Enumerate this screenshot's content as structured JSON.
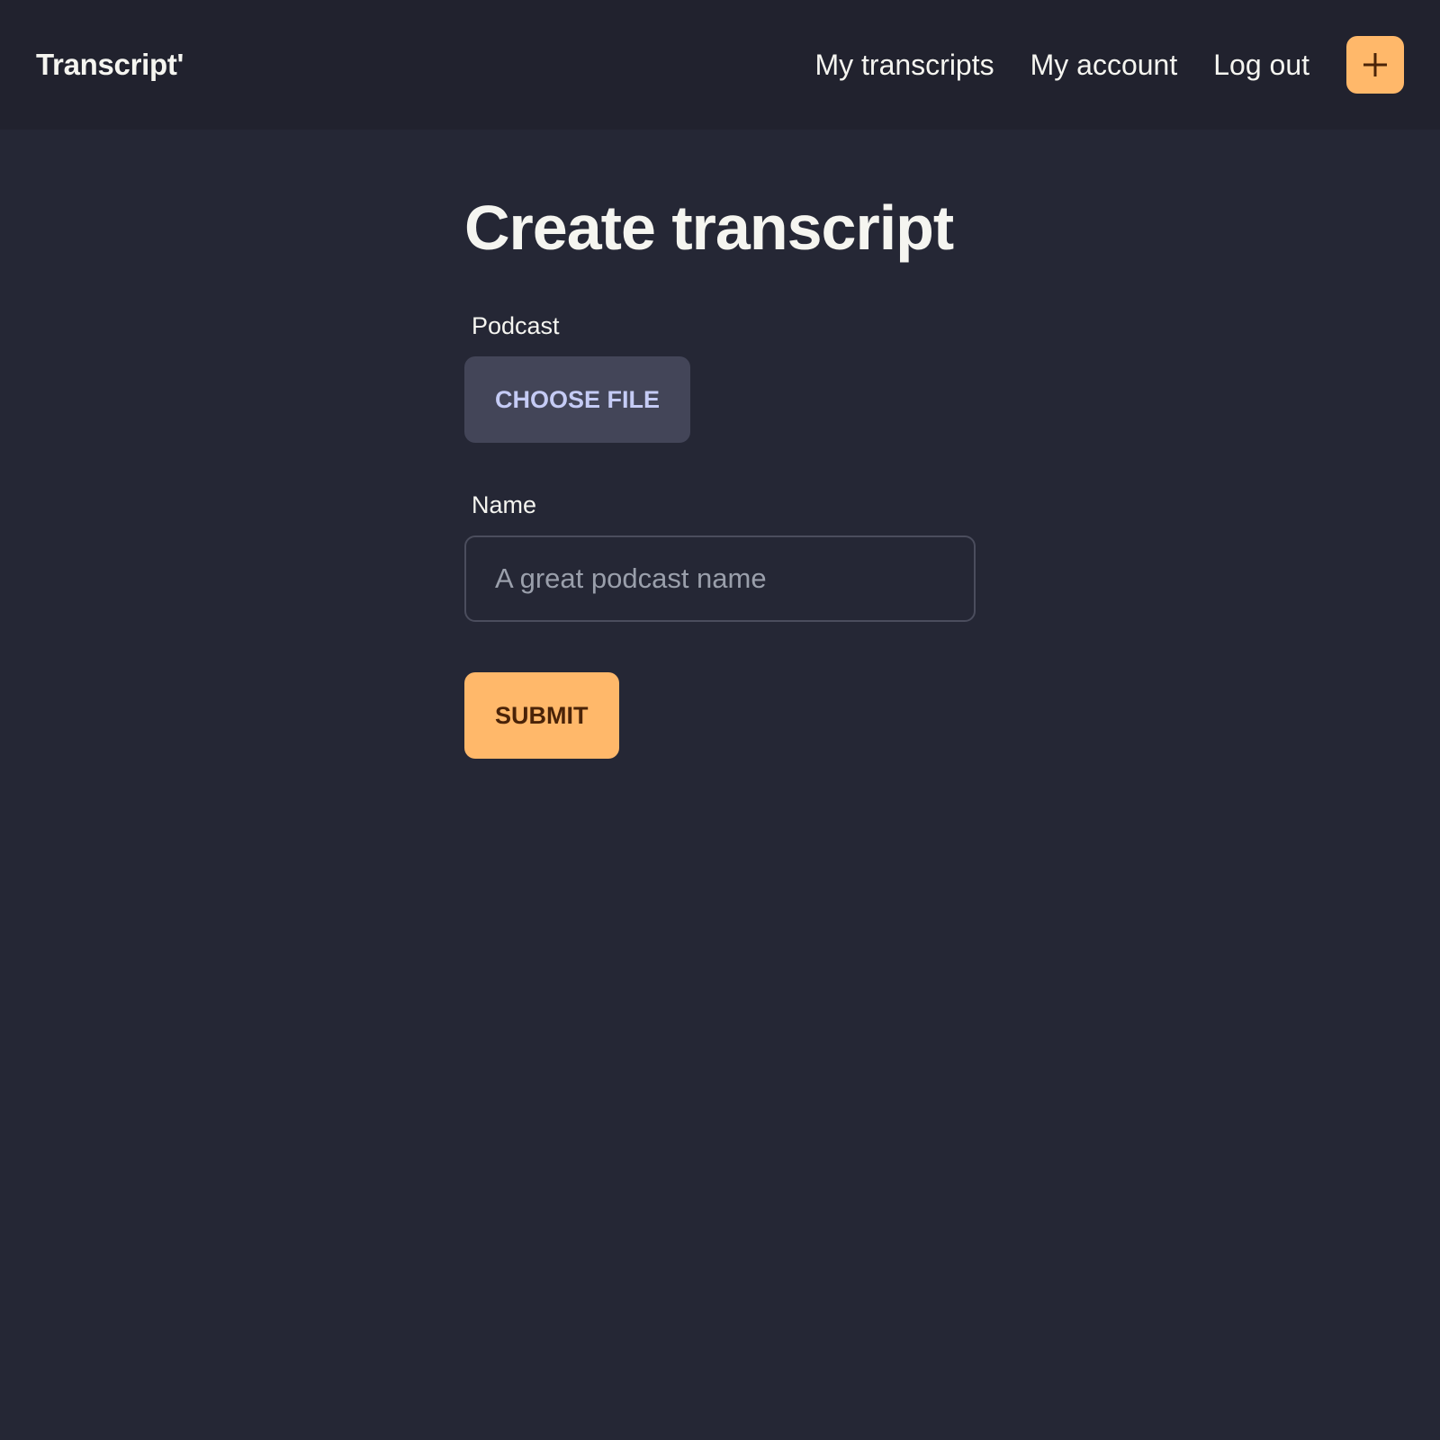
{
  "navbar": {
    "brand": "Transcript'",
    "links": [
      {
        "label": "My transcripts"
      },
      {
        "label": "My account"
      },
      {
        "label": "Log out"
      }
    ],
    "add_button": {
      "icon": "plus-icon",
      "color": "#ffb86a"
    }
  },
  "main": {
    "title": "Create transcript",
    "podcast_field": {
      "label": "Podcast",
      "button_label": "CHOOSE FILE"
    },
    "name_field": {
      "label": "Name",
      "value": "",
      "placeholder": "A great podcast name"
    },
    "submit_label": "SUBMIT"
  },
  "colors": {
    "background": "#252735",
    "navbar": "#21222e",
    "accent": "#ffb86a",
    "secondary_button": "#434558"
  }
}
